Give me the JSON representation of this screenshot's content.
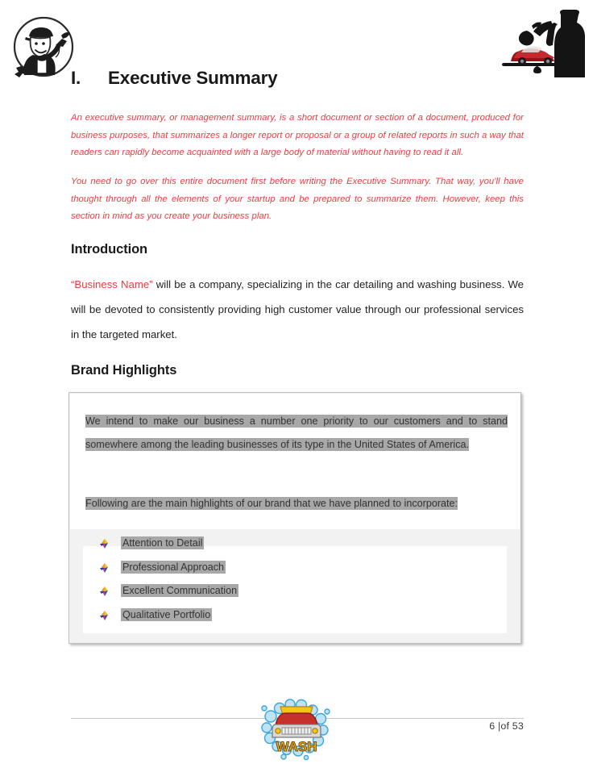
{
  "document": {
    "section_numeral": "I.",
    "section_title": "Executive Summary",
    "red_notes": [
      "An executive summary, or management summary, is a short document or section of a document, produced for business purposes, that summarizes a longer report or proposal or a group of related reports in such a way that readers can rapidly become acquainted with a large body of material without having to read it all.",
      "You need to go over this entire document first before writing the Executive Summary. That way, you'll have thought through all the elements of your startup and be prepared to summarize them. However, keep this section in mind as you create your business plan."
    ],
    "introduction": {
      "heading": "Introduction",
      "business_name_placeholder": "“Business Name”",
      "paragraph": " will be a company, specializing in the car detailing and washing business. We will be devoted to consistently providing high customer value through our professional services in the targeted market."
    },
    "brand_highlights": {
      "heading": "Brand Highlights",
      "paragraph_1": "We intend to make our business a number one priority to our customers and to stand somewhere among the leading businesses of its type in the United States of America.",
      "paragraph_2": "Following are the main highlights of our brand that we have planned to incorporate:",
      "items": [
        "Attention to Detail",
        "Professional Approach",
        "Excellent Communication",
        "Qualitative Portfolio"
      ]
    }
  },
  "header": {
    "left_logo_name": "detailer-mascot-logo",
    "right_logo_name": "waiter-serving-car-logo"
  },
  "footer": {
    "logo_name": "car-wash-logo",
    "logo_text": "WASH",
    "page_label": "6 |of 53"
  },
  "colors": {
    "red_accent": "#ee3b3e",
    "highlight_gray": "#a8a8a8",
    "box_fill": "#f2f2f2",
    "box_border": "#bfbfbf",
    "body_text": "#231f20"
  },
  "icons": {
    "bullet": "four-color-diamond-bullet-icon"
  }
}
